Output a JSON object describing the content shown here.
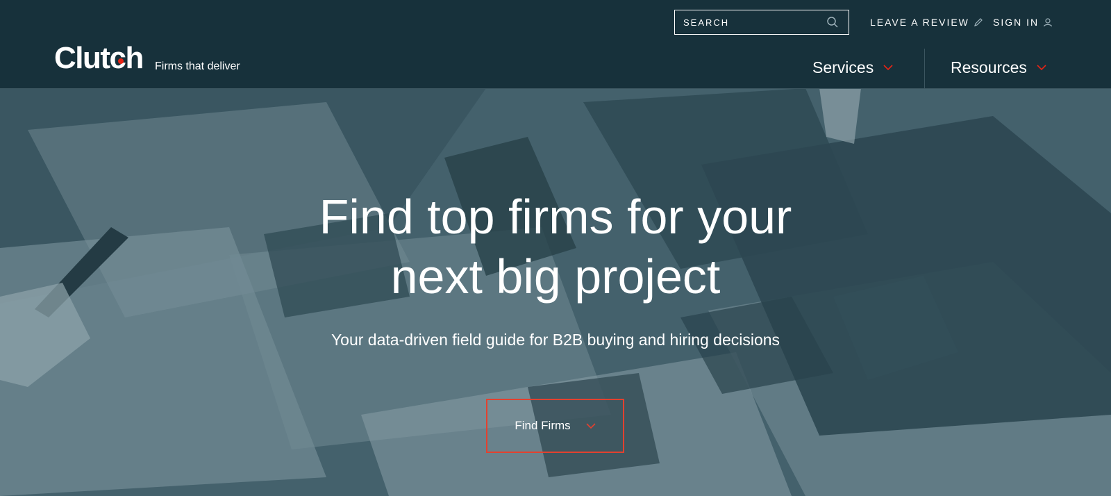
{
  "header": {
    "logo_text": "Clutch",
    "tagline": "Firms that deliver",
    "search": {
      "placeholder": "SEARCH",
      "value": "",
      "icon": "search-icon"
    },
    "leave_review": {
      "label": "LEAVE A REVIEW",
      "icon": "pencil-icon"
    },
    "sign_in": {
      "label": "SIGN IN",
      "icon": "user-icon"
    },
    "nav": [
      {
        "label": "Services",
        "icon": "chevron-down-icon"
      },
      {
        "label": "Resources",
        "icon": "chevron-down-icon"
      }
    ]
  },
  "hero": {
    "title_line1": "Find top firms for your",
    "title_line2": "next big project",
    "subtitle": "Your data-driven field guide for B2B buying and hiring decisions",
    "cta": {
      "label": "Find Firms",
      "icon": "chevron-down-icon"
    }
  },
  "colors": {
    "header_bg": "#17313b",
    "hero_tint": "#4e6974",
    "accent": "#e62415"
  }
}
